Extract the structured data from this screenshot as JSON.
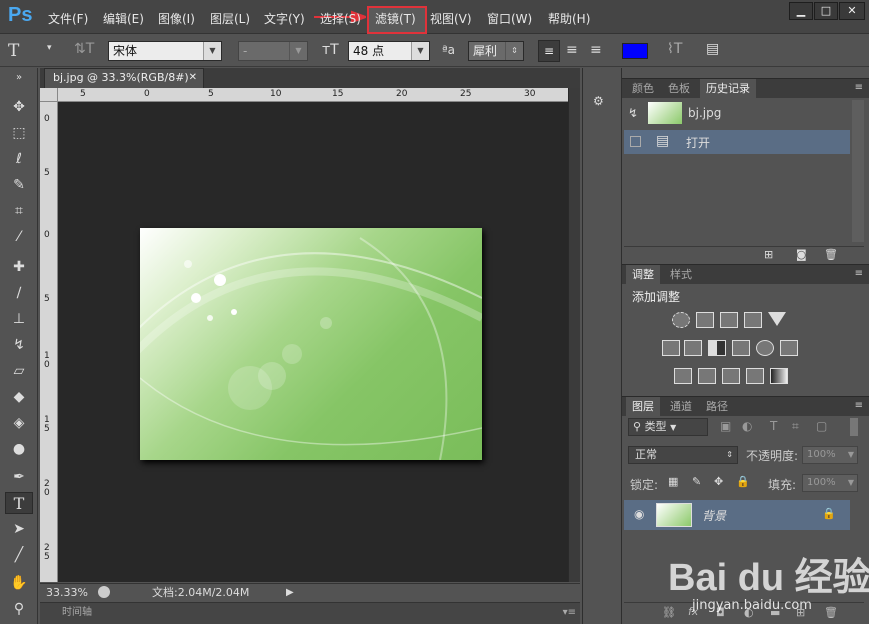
{
  "app": {
    "logo": "Ps"
  },
  "menu": [
    "文件(F)",
    "编辑(E)",
    "图像(I)",
    "图层(L)",
    "文字(Y)",
    "选择(S)",
    "滤镜(T)",
    "视图(V)",
    "窗口(W)",
    "帮助(H)"
  ],
  "window_controls": {
    "min": "▁",
    "max": "□",
    "close": "✕"
  },
  "options": {
    "font_family": "宋体",
    "font_style": "-",
    "font_size": "48 点",
    "aa_label": "ªa",
    "aa_mode": "犀利",
    "color": "#0000ff"
  },
  "document": {
    "tab_title": "bj.jpg @ 33.3%(RGB/8#)",
    "tab_close": "✕",
    "zoom": "33.33%",
    "doc_info": "文档:2.04M/2.04M",
    "timeline_label": "时间轴"
  },
  "ruler": {
    "h": [
      "5",
      "0",
      "5",
      "10",
      "15",
      "20",
      "25",
      "30"
    ],
    "v": [
      "0",
      "5",
      "0",
      "5",
      "1\n0",
      "1\n5",
      "2\n0",
      "2\n5"
    ]
  },
  "panels": {
    "top_tabs": [
      "颜色",
      "色板",
      "历史记录"
    ],
    "history": {
      "snapshot": "bj.jpg",
      "items": [
        "打开"
      ]
    },
    "adj_tabs": [
      "调整",
      "样式"
    ],
    "adj_title": "添加调整",
    "layer_tabs": [
      "图层",
      "通道",
      "路径"
    ],
    "layer_filter": "类型",
    "blend": "正常",
    "opacity_label": "不透明度:",
    "opacity": "100%",
    "lock_label": "锁定:",
    "fill_label": "填充:",
    "fill": "100%",
    "layers": [
      {
        "name": "背景"
      }
    ]
  },
  "watermark": {
    "brand": "Bai du 经验",
    "url": "jingyan.baidu.com"
  },
  "colors": {
    "highlight": "#e0323a",
    "selected_row": "#5a6d85"
  }
}
